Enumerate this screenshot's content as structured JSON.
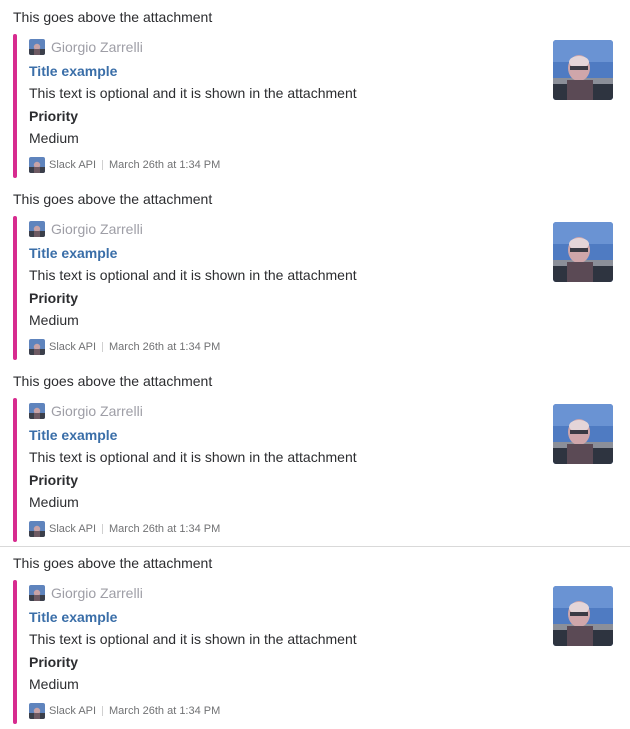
{
  "colors": {
    "attachment_bar": "#d72b8f",
    "title_link": "#3a6ea8",
    "author_name": "#9e9ea6",
    "footer_text": "#717274",
    "divider": "#d9d9d9"
  },
  "messages": [
    {
      "pretext": "This goes above the attachment",
      "attachment": {
        "author_name": "Giorgio Zarrelli",
        "author_icon": "author-avatar-icon",
        "title": "Title example",
        "text": "This text is optional and it is shown in the attachment",
        "field_title": "Priority",
        "field_value": "Medium",
        "footer": "Slack API",
        "footer_icon": "slack-api-icon",
        "timestamp": "March 26th at 1:34 PM",
        "thumb": "author-photo-thumbnail"
      }
    },
    {
      "pretext": "This goes above the attachment",
      "attachment": {
        "author_name": "Giorgio Zarrelli",
        "author_icon": "author-avatar-icon",
        "title": "Title example",
        "text": "This text is optional and it is shown in the attachment",
        "field_title": "Priority",
        "field_value": "Medium",
        "footer": "Slack API",
        "footer_icon": "slack-api-icon",
        "timestamp": "March 26th at 1:34 PM",
        "thumb": "author-photo-thumbnail"
      }
    },
    {
      "pretext": "This goes above the attachment",
      "attachment": {
        "author_name": "Giorgio Zarrelli",
        "author_icon": "author-avatar-icon",
        "title": "Title example",
        "text": "This text is optional and it is shown in the attachment",
        "field_title": "Priority",
        "field_value": "Medium",
        "footer": "Slack API",
        "footer_icon": "slack-api-icon",
        "timestamp": "March 26th at 1:34 PM",
        "thumb": "author-photo-thumbnail"
      }
    },
    {
      "pretext": "This goes above the attachment",
      "attachment": {
        "author_name": "Giorgio Zarrelli",
        "author_icon": "author-avatar-icon",
        "title": "Title example",
        "text": "This text is optional and it is shown in the attachment",
        "field_title": "Priority",
        "field_value": "Medium",
        "footer": "Slack API",
        "footer_icon": "slack-api-icon",
        "timestamp": "March 26th at 1:34 PM",
        "thumb": "author-photo-thumbnail"
      }
    }
  ]
}
